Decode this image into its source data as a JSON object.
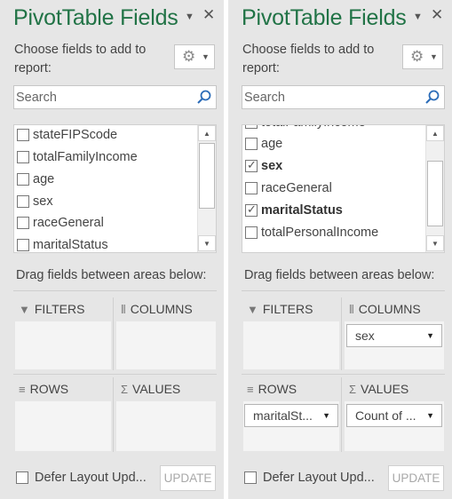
{
  "colors": {
    "title_green": "#217346",
    "pane_bg": "#e6e6e6",
    "area_bg": "#f4f4f4"
  },
  "panes": [
    {
      "title": "PivotTable Fields",
      "dropdown_icon": "caret-down-icon",
      "close_icon": "close-icon",
      "choose_text": "Choose fields to add to report:",
      "gear_icon": "gear-icon",
      "search_placeholder": "Search",
      "search_icon": "search-icon",
      "fields": [
        {
          "label": "stateFIPScode",
          "checked": false
        },
        {
          "label": "totalFamilyIncome",
          "checked": false
        },
        {
          "label": "age",
          "checked": false
        },
        {
          "label": "sex",
          "checked": false
        },
        {
          "label": "raceGeneral",
          "checked": false
        },
        {
          "label": "maritalStatus",
          "checked": false
        }
      ],
      "scroll_position": 0.0,
      "drag_text": "Drag fields between areas below:",
      "areas": {
        "filters": {
          "label": "FILTERS",
          "icon": "filter-icon",
          "items": []
        },
        "columns": {
          "label": "COLUMNS",
          "icon": "columns-icon",
          "items": []
        },
        "rows": {
          "label": "ROWS",
          "icon": "rows-icon",
          "items": []
        },
        "values": {
          "label": "VALUES",
          "icon": "sigma-icon",
          "items": []
        }
      },
      "defer_label": "Defer Layout Upd...",
      "defer_checked": false,
      "update_label": "UPDATE"
    },
    {
      "title": "PivotTable Fields",
      "dropdown_icon": "caret-down-icon",
      "close_icon": "close-icon",
      "choose_text": "Choose fields to add to report:",
      "gear_icon": "gear-icon",
      "search_placeholder": "Search",
      "search_icon": "search-icon",
      "partial_field": "totalFamilyIncome",
      "fields": [
        {
          "label": "age",
          "checked": false
        },
        {
          "label": "sex",
          "checked": true
        },
        {
          "label": "raceGeneral",
          "checked": false
        },
        {
          "label": "maritalStatus",
          "checked": true
        },
        {
          "label": "totalPersonalIncome",
          "checked": false
        }
      ],
      "scroll_position": 0.35,
      "drag_text": "Drag fields between areas below:",
      "areas": {
        "filters": {
          "label": "FILTERS",
          "icon": "filter-icon",
          "items": []
        },
        "columns": {
          "label": "COLUMNS",
          "icon": "columns-icon",
          "items": [
            "sex"
          ]
        },
        "rows": {
          "label": "ROWS",
          "icon": "rows-icon",
          "items": [
            "maritalSt..."
          ]
        },
        "values": {
          "label": "VALUES",
          "icon": "sigma-icon",
          "items": [
            "Count of ..."
          ]
        }
      },
      "defer_label": "Defer Layout Upd...",
      "defer_checked": false,
      "update_label": "UPDATE"
    }
  ]
}
